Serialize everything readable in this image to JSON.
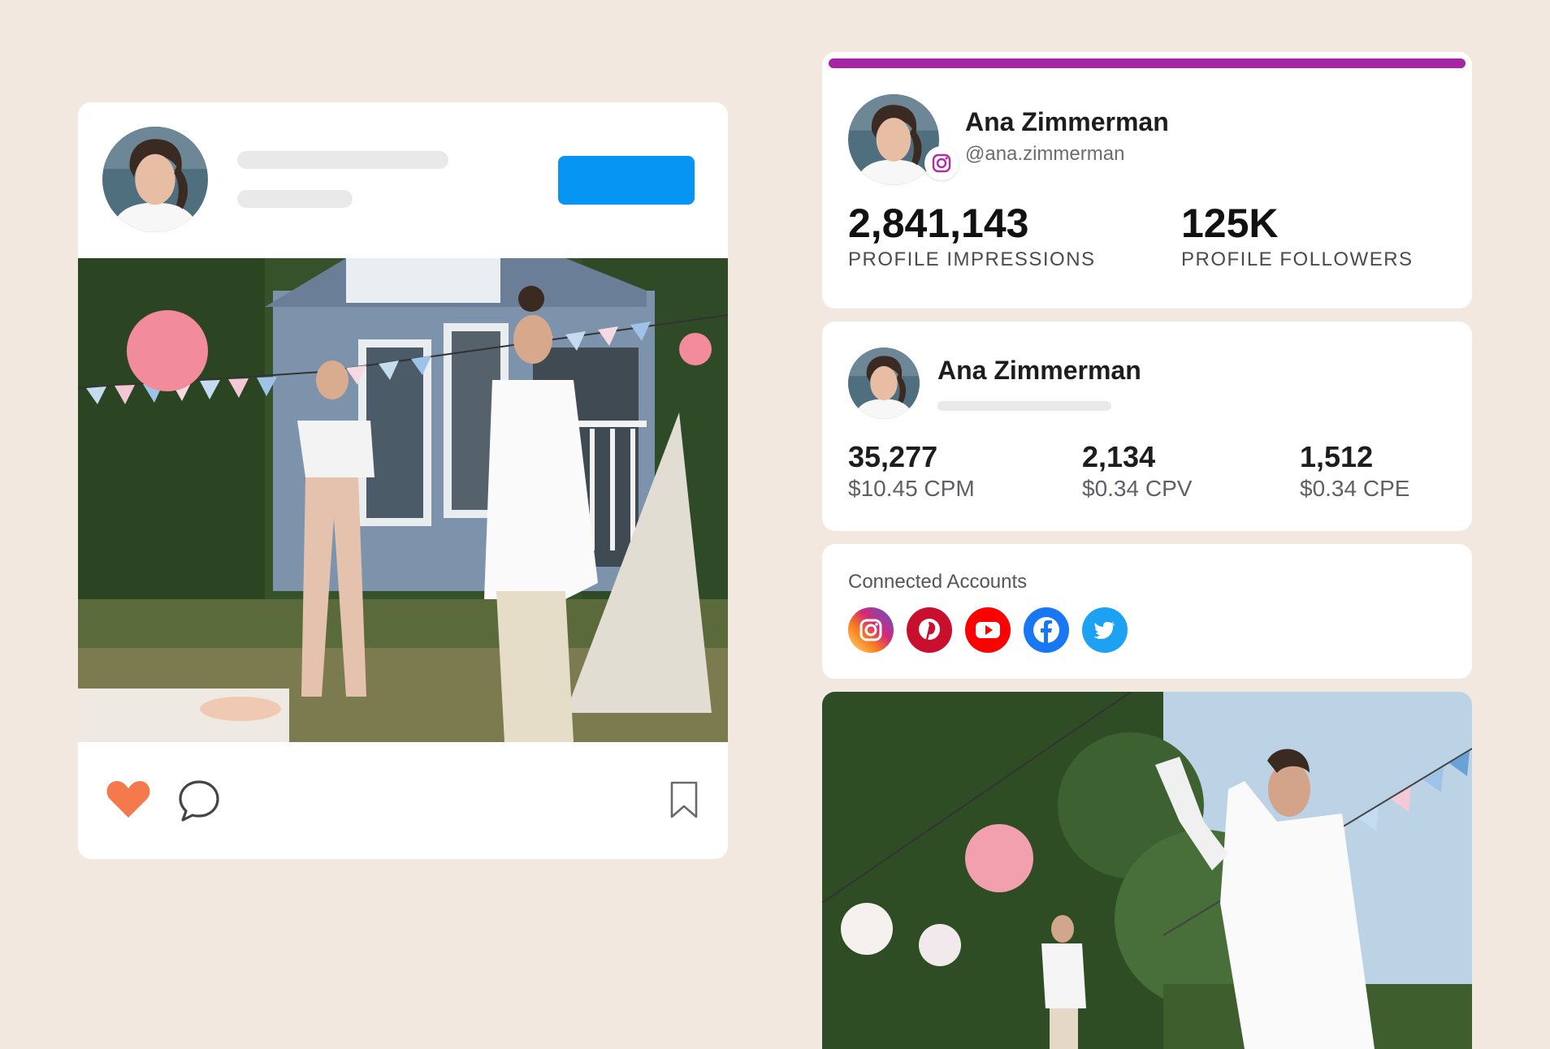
{
  "post": {
    "icons": [
      "heart-icon",
      "comment-icon",
      "bookmark-icon"
    ]
  },
  "profile": {
    "name": "Ana Zimmerman",
    "handle": "@ana.zimmerman",
    "progress": 1.0,
    "accent_color": "#a526a2",
    "impressions_value": "2,841,143",
    "impressions_label": "PROFILE IMPRESSIONS",
    "followers_value": "125K",
    "followers_label": "PROFILE FOLLOWERS"
  },
  "metrics": {
    "name": "Ana Zimmerman",
    "items": [
      {
        "value": "35,277",
        "sub": "$10.45 CPM"
      },
      {
        "value": "2,134",
        "sub": "$0.34 CPV"
      },
      {
        "value": "1,512",
        "sub": "$0.34 CPE"
      }
    ]
  },
  "accounts": {
    "label": "Connected Accounts",
    "items": [
      {
        "icon": "instagram-icon",
        "color": "#d62976"
      },
      {
        "icon": "pinterest-icon",
        "color": "#c8102e"
      },
      {
        "icon": "youtube-icon",
        "color": "#ff0000"
      },
      {
        "icon": "facebook-icon",
        "color": "#1877f2"
      },
      {
        "icon": "twitter-icon",
        "color": "#1da1f2"
      }
    ]
  },
  "colors": {
    "background": "#f2e8df",
    "follow_button": "#0795f4",
    "heart": "#f47a4d"
  }
}
